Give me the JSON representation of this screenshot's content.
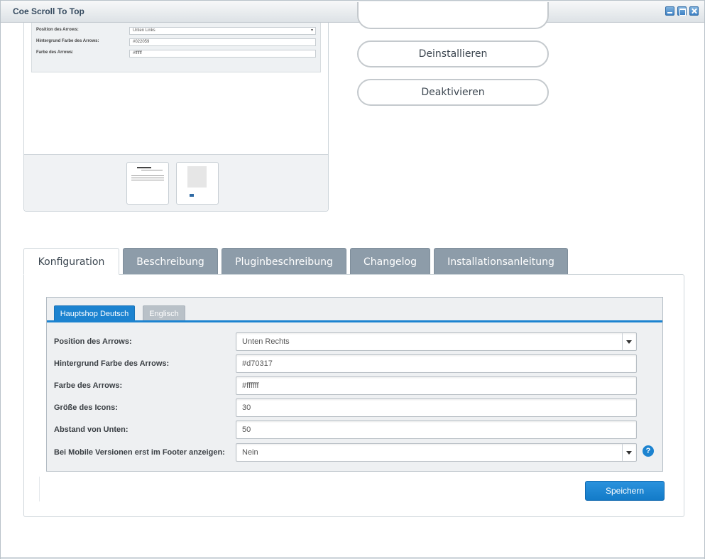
{
  "window": {
    "title": "Coe Scroll To Top"
  },
  "preview": {
    "rows": [
      {
        "label": "Position des Arrows:",
        "value": "Unten Links"
      },
      {
        "label": "Hintergrund Farbe des Arrows:",
        "value": "#022059"
      },
      {
        "label": "Farbe des Arrows:",
        "value": "#ffffff"
      }
    ]
  },
  "actions": {
    "uninstall": "Deinstallieren",
    "deactivate": "Deaktivieren"
  },
  "tabs": [
    {
      "label": "Konfiguration",
      "active": true
    },
    {
      "label": "Beschreibung"
    },
    {
      "label": "Pluginbeschreibung"
    },
    {
      "label": "Changelog"
    },
    {
      "label": "Installationsanleitung"
    }
  ],
  "config": {
    "shop_tabs": [
      "Hauptshop Deutsch",
      "Englisch"
    ],
    "fields": [
      {
        "label": "Position des Arrows:",
        "value": "Unten Rechts",
        "type": "select"
      },
      {
        "label": "Hintergrund Farbe des Arrows:",
        "value": "#d70317",
        "type": "text"
      },
      {
        "label": "Farbe des Arrows:",
        "value": "#ffffff",
        "type": "text"
      },
      {
        "label": "Größe des Icons:",
        "value": "30",
        "type": "text"
      },
      {
        "label": "Abstand von Unten:",
        "value": "50",
        "type": "text"
      },
      {
        "label": "Bei Mobile Versionen erst im Footer anzeigen:",
        "value": "Nein",
        "type": "select"
      }
    ],
    "help_glyph": "?",
    "save_label": "Speichern"
  },
  "colors": {
    "accent": "#1c83d0",
    "tab_inactive": "#8d9ca9"
  }
}
